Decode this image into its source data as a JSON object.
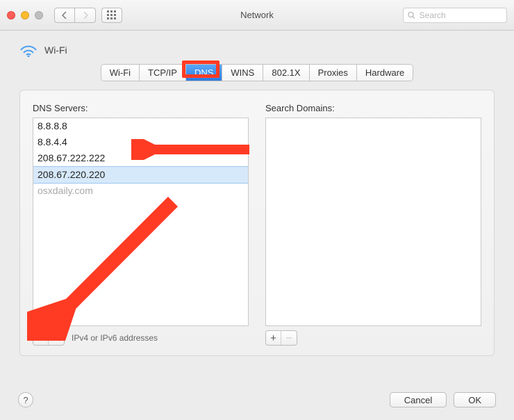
{
  "window": {
    "title": "Network",
    "search_placeholder": "Search"
  },
  "interface": {
    "name": "Wi-Fi"
  },
  "tabs": [
    "Wi-Fi",
    "TCP/IP",
    "DNS",
    "WINS",
    "802.1X",
    "Proxies",
    "Hardware"
  ],
  "active_tab": "DNS",
  "dns": {
    "label": "DNS Servers:",
    "servers": [
      "8.8.8.8",
      "8.8.4.4",
      "208.67.222.222",
      "208.67.220.220"
    ],
    "selected_index": 3,
    "watermark": "osxdaily.com",
    "footer_hint": "IPv4 or IPv6 addresses"
  },
  "search_domains": {
    "label": "Search Domains:",
    "items": []
  },
  "buttons": {
    "cancel": "Cancel",
    "ok": "OK",
    "help": "?"
  },
  "annotation": {
    "highlight_tab": "DNS",
    "color": "#ff3b24"
  }
}
